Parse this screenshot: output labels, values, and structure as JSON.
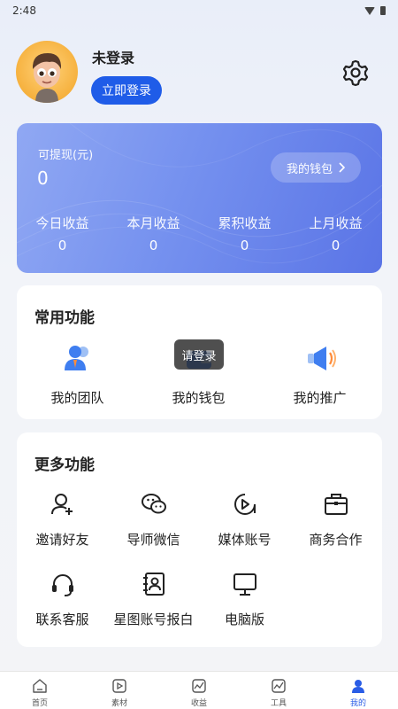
{
  "status_bar": {
    "time": "2:48"
  },
  "profile": {
    "username": "未登录",
    "login_button": "立即登录"
  },
  "wallet": {
    "withdrawable_label": "可提现(元)",
    "withdrawable_value": "0",
    "my_wallet_button": "我的钱包",
    "stats": [
      {
        "label": "今日收益",
        "value": "0"
      },
      {
        "label": "本月收益",
        "value": "0"
      },
      {
        "label": "累积收益",
        "value": "0"
      },
      {
        "label": "上月收益",
        "value": "0"
      }
    ]
  },
  "common_functions": {
    "title": "常用功能",
    "items": [
      {
        "label": "我的团队",
        "icon": "team-icon"
      },
      {
        "label": "我的钱包",
        "icon": "wallet-icon"
      },
      {
        "label": "我的推广",
        "icon": "megaphone-icon"
      }
    ]
  },
  "tooltip": "请登录",
  "more_functions": {
    "title": "更多功能",
    "items": [
      {
        "label": "邀请好友",
        "icon": "invite-friend-icon"
      },
      {
        "label": "导师微信",
        "icon": "wechat-icon"
      },
      {
        "label": "媒体账号",
        "icon": "media-account-icon"
      },
      {
        "label": "商务合作",
        "icon": "briefcase-icon"
      },
      {
        "label": "联系客服",
        "icon": "headset-icon"
      },
      {
        "label": "星图账号报白",
        "icon": "contact-book-icon"
      },
      {
        "label": "电脑版",
        "icon": "monitor-icon"
      }
    ]
  },
  "tabbar": {
    "items": [
      {
        "label": "首页",
        "icon": "home-icon"
      },
      {
        "label": "素材",
        "icon": "material-icon"
      },
      {
        "label": "收益",
        "icon": "earnings-icon"
      },
      {
        "label": "工具",
        "icon": "tools-icon"
      },
      {
        "label": "我的",
        "icon": "profile-icon",
        "active": true
      }
    ]
  },
  "colors": {
    "primary": "#1f5ce8",
    "active_tab": "#2a5de6",
    "card_gradient_start": "#90a8f3",
    "card_gradient_end": "#5a74e6"
  }
}
